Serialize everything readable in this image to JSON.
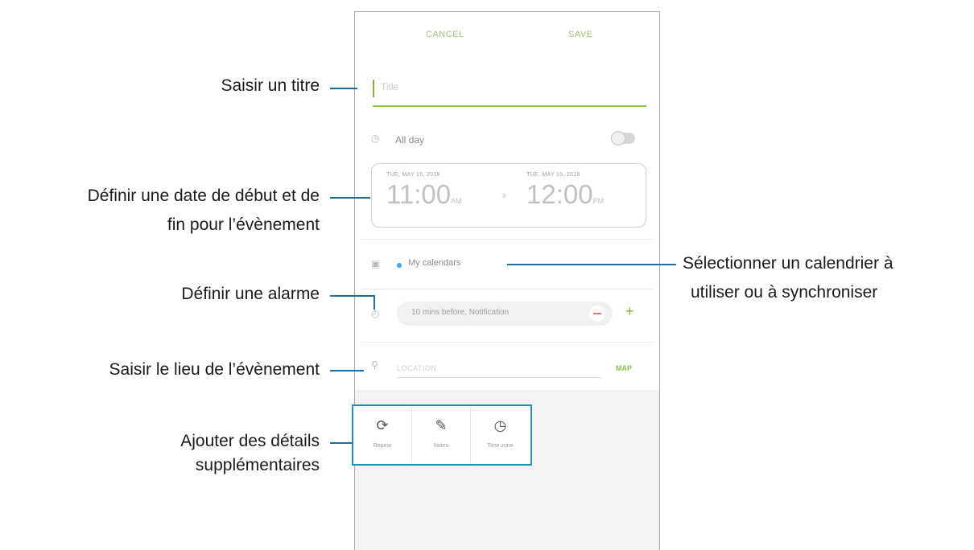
{
  "app": {
    "cancel_label": "CANCEL",
    "save_label": "SAVE",
    "title_placeholder": "Title",
    "all_day_label": "All day",
    "start_date": "TUE, MAY 15, 2018",
    "start_time": "11:00",
    "start_ampm": "AM",
    "end_date": "TUE, MAY 15, 2018",
    "end_time": "12:00",
    "end_ampm": "PM",
    "calendar_label": "My calendars",
    "alarm_label": "10 mins before, Notification",
    "location_placeholder": "LOCATION",
    "map_label": "MAP",
    "extras": [
      {
        "label": "Repeat",
        "icon": "repeat-icon"
      },
      {
        "label": "Notes",
        "icon": "notes-icon"
      },
      {
        "label": "Time zone",
        "icon": "time-zone-icon"
      }
    ]
  },
  "annotations": {
    "title": "Saisir un titre",
    "dates_line1": "Définir une date de début et de",
    "dates_line2": "fin pour l’évènement",
    "calendar_line1": "Sélectionner un calendrier à",
    "calendar_line2": "utiliser ou à synchroniser",
    "alarm": "Définir une alarme",
    "location": "Saisir le lieu de l’évènement",
    "details_line1": "Ajouter des détails",
    "details_line2": "supplémentaires"
  },
  "colors": {
    "accent_green": "#7cb342",
    "callout_blue": "#1f6f9e",
    "frame_highlight": "#1f8ebd"
  }
}
